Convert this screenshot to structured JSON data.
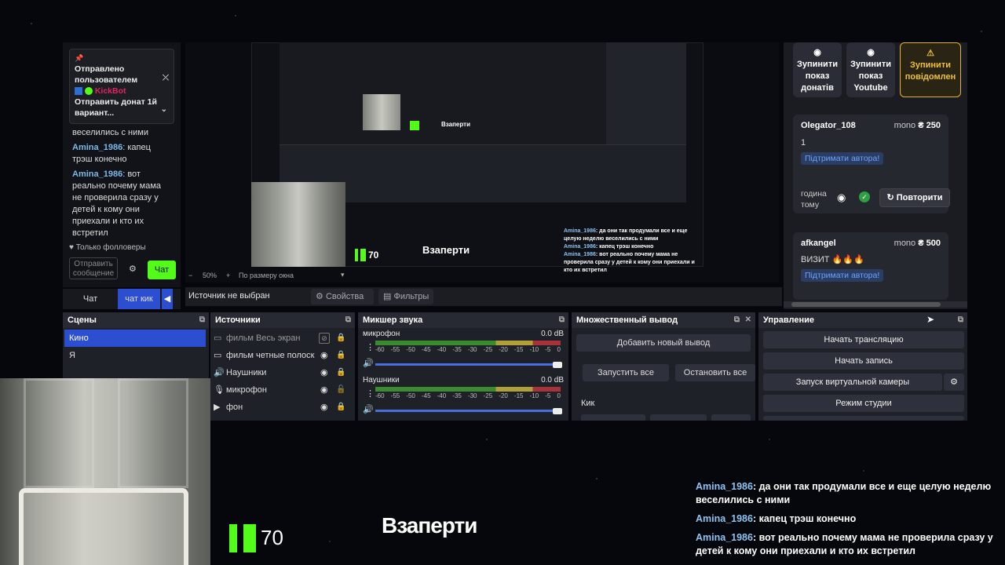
{
  "left_chat": {
    "pinned_sent": "Отправлено пользователем",
    "pinned_user": "KickBot",
    "pinned_text": "Отправить донат 1й вариант...",
    "partial_top": "целую неделю",
    "partial_line": "веселились с ними",
    "messages": [
      {
        "nick": "Amina_1986",
        "text": ": капец трэш конечно"
      },
      {
        "nick": "Amina_1986",
        "text": ": вот реально почему мама не проверила сразу у детей к кому они приехали и кто их встретил"
      }
    ],
    "followers_only": "Только фолловеры",
    "input_placeholder": "Отправить сообщение",
    "send_label": "Чат",
    "tab_chat": "Чат",
    "tab_kick": "чат кик"
  },
  "preview": {
    "zoom": "50%",
    "fit_label": "По размеру окна",
    "overlay_title": "Взаперти",
    "kick_count": "70",
    "chat_lines": [
      {
        "nick": "Amina_1986",
        "text": ": да они так продумали все и еще целую неделю веселились с ними"
      },
      {
        "nick": "Amina_1986",
        "text": ": капец трэш конечно"
      },
      {
        "nick": "Amina_1986",
        "text": ": вот реально почему мама не проверила сразу у детей к кому они приехали и кто их встретил"
      }
    ]
  },
  "source_bar": {
    "no_source": "Источник не выбран",
    "properties": "Свойства",
    "filters": "Фильтры"
  },
  "right_panel": {
    "stop_donations": "Зупинити показ донатів",
    "stop_youtube": "Зупинити показ Youtube",
    "stop_notifications": "Зупинити повідомлен",
    "donations": [
      {
        "name": "Olegator_108",
        "amount": "₴ 250",
        "currency": "mono",
        "message": "1",
        "support": "Підтримати автора!",
        "time": "година тому",
        "repeat": "Повторити"
      },
      {
        "name": "afkangel",
        "amount": "₴ 500",
        "currency": "mono",
        "message": "ВИЗИТ 🔥🔥🔥",
        "support": "Підтримати автора!"
      }
    ]
  },
  "scenes": {
    "title": "Сцены",
    "items": [
      "Кино",
      "Я"
    ]
  },
  "sources": {
    "title": "Источники",
    "items": [
      {
        "icon": "monitor-icon",
        "label": "фильм Весь экран"
      },
      {
        "icon": "monitor-icon",
        "label": "фильм четные полоск"
      },
      {
        "icon": "speaker-icon",
        "label": "Наушники"
      },
      {
        "icon": "microphone-icon",
        "label": "микрофон"
      },
      {
        "icon": "play-icon",
        "label": "фон"
      }
    ]
  },
  "mixer": {
    "title": "Микшер звука",
    "channels": [
      {
        "name": "микрофон",
        "db": "0.0 dB"
      },
      {
        "name": "Наушники",
        "db": "0.0 dB"
      }
    ],
    "ticks": [
      "-60",
      "-55",
      "-50",
      "-45",
      "-40",
      "-35",
      "-30",
      "-25",
      "-20",
      "-15",
      "-10",
      "-5",
      "0"
    ]
  },
  "multi_output": {
    "title": "Множественный вывод",
    "add": "Добавить новый вывод",
    "start_all": "Запустить все",
    "stop_all": "Остановить все",
    "group": "Кик"
  },
  "controls": {
    "title": "Управление",
    "start_stream": "Начать трансляцию",
    "start_record": "Начать запись",
    "virtual_cam": "Запуск виртуальной камеры",
    "studio_mode": "Режим студии"
  },
  "overlay": {
    "kick_count": "70",
    "title": "Взаперти",
    "chat": [
      {
        "nick": "Amina_1986",
        "text": ": да они так продумали все и еще целую неделю веселились с ними"
      },
      {
        "nick": "Amina_1986",
        "text": ": капец трэш конечно"
      },
      {
        "nick": "Amina_1986",
        "text": ": вот реально почему мама не проверила сразу у детей к кому они приехали и кто их встретил"
      }
    ]
  },
  "colors": {
    "kick_green": "#53fc18",
    "accent_blue": "#2c4fd1",
    "warn_yellow": "#e6b422",
    "nick_blue": "#7ab8e8"
  }
}
